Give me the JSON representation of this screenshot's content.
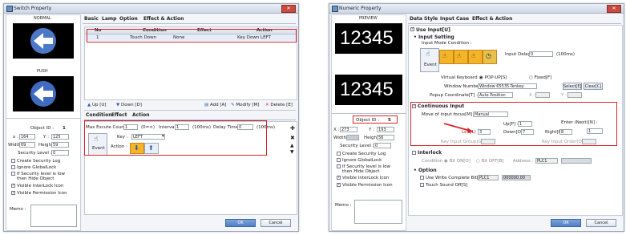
{
  "left": {
    "title": "Switch Property",
    "preview_normal": "NORMAL",
    "preview_push": "PUSH",
    "tabs": [
      "Basic",
      "Lamp",
      "Option",
      "Effect & Action"
    ],
    "table_headers": [
      "No",
      "Condition",
      "Effect",
      "Action"
    ],
    "table_row": {
      "no": "1",
      "condition": "Touch Down",
      "effect": "None",
      "action": "Key Down LEFT"
    },
    "toolbar": {
      "up": "Up [U]",
      "down": "Down [D]",
      "add": "Add [A]",
      "modify": "Modify [M]",
      "delete": "Delete [E]"
    },
    "subtabs": [
      "Condition",
      "Effect",
      "Action"
    ],
    "max_execute_label": "Max Excute Count :",
    "max_execute_value": "1",
    "max_execute_unit": "(0=∞)",
    "interval_label": "Interval :",
    "interval_value": "1",
    "interval_unit": "(100ms)",
    "delay_label": "Delay Time :",
    "delay_value": "0",
    "delay_unit": "(100ms)",
    "event_label": "Event",
    "key_label": "Key :",
    "key_value": "LEFT",
    "action_label": "Action :",
    "object_id_label": "Object ID :",
    "object_id_value": "1",
    "x_label": "x :",
    "x_value": "164",
    "y_label": "Y :",
    "y_value": "125",
    "width_label": "Width :",
    "width_value": "69",
    "height_label": "Height :",
    "height_value": "59",
    "security_label": "Security Level :",
    "security_value": "0",
    "checks": [
      {
        "label": "Create Security Log",
        "on": false
      },
      {
        "label": "Ignore GlobalLock",
        "on": false
      },
      {
        "label": "If Security level is low then Hide Object",
        "on": false
      },
      {
        "label": "Visible InterLock Icon",
        "on": true
      },
      {
        "label": "Visible Permission Icon",
        "on": true
      }
    ],
    "memo_label": "Memo :",
    "ok": "OK",
    "cancel": "Cancel"
  },
  "right": {
    "title": "Numeric Property",
    "preview_label": "PREVIEW",
    "display_value_1": "12345",
    "display_value_2": "12345",
    "tabs": [
      "Data",
      "Style",
      "Input",
      "Case",
      "Effect & Action"
    ],
    "use_input_label": "Use Input[U]",
    "input_setting": "Input Setting",
    "input_mode_label": "Input Mode Condition :",
    "input_delay_label": "Input Delay :",
    "input_delay_value": "0",
    "input_delay_unit": "(100ms)",
    "event_label": "Event",
    "virtual_keyboard_label": "Virtual Keyboard :",
    "popup_option": "POP-UP[S]",
    "fixed_option": "Fixed[F]",
    "window_number_label": "Window Number :",
    "window_number_value": "Window 65535-Tenkey",
    "select_btn": "Select[E]",
    "clear_btn": "Clear[C]",
    "popup_coord_label": "Popup Coordinate[T] :",
    "popup_coord_value": "Auto Position",
    "x_small": "X :",
    "y_small": "Y :",
    "object_id_label": "Object ID :",
    "object_id_value": "5",
    "x_label": "X :",
    "x_value": "273",
    "y_label": "Y :",
    "y_value": "193",
    "width_label": "Width :",
    "height_label": "Height :",
    "height_value": "56",
    "security_label": "Security Level :",
    "security_value": "0",
    "checks": [
      {
        "label": "Create Security Log",
        "on": false
      },
      {
        "label": "Ignore GlobalLock",
        "on": false
      },
      {
        "label": "If Security level is low then Hide Object",
        "on": false
      },
      {
        "label": "Visible InterLock Icon",
        "on": true
      },
      {
        "label": "Visible Permission Icon",
        "on": true
      }
    ],
    "memo_label": "Memo :",
    "continuous_input": "Continuous Input",
    "move_focus_label": "Move of input focus[M] :",
    "move_focus_value": "Manual",
    "enter_label": "Enter (Next)[N] :",
    "enter_value": "1",
    "up_label": "Up[P] :",
    "up_value": "1",
    "left_label": "Left[L] :",
    "left_value": "3",
    "down_label": "Down[D] :",
    "down_value": "7",
    "right_label": "Right[R] :",
    "right_value": "8",
    "key_input_group_label": "Key Input Group[G] :",
    "key_input_order_label": "Key Input Order[O] :",
    "interlock": "Interlock",
    "condition_label": "Condition :",
    "bit_on": "Bit ON[O]",
    "bit_off": "Bit OFF[B]",
    "address_label": "Address :",
    "address_value": "PLC1",
    "option": "Option",
    "use_write_label": "Use Write Complete Bit[W] :",
    "write_plc": "PLC1",
    "write_value": "000000.00",
    "touch_sound_label": "Touch Sound Off[S]",
    "ok": "OK",
    "cancel": "Cancel"
  }
}
